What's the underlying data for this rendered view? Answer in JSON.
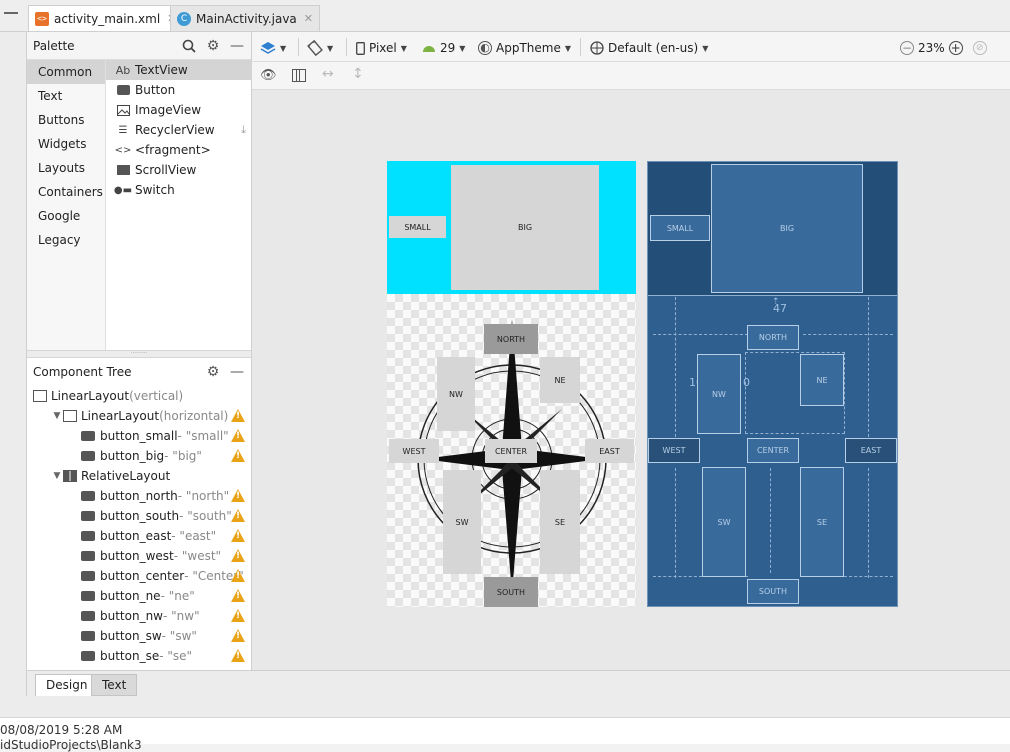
{
  "tabs": [
    {
      "label": "activity_main.xml",
      "icon": "xml-file-icon",
      "active": true
    },
    {
      "label": "MainActivity.java",
      "icon": "java-class-icon",
      "active": false
    }
  ],
  "palette": {
    "title": "Palette",
    "categories": [
      "Common",
      "Text",
      "Buttons",
      "Widgets",
      "Layouts",
      "Containers",
      "Google",
      "Legacy"
    ],
    "selected_category": "Common",
    "widgets": [
      {
        "label": "TextView",
        "icon": "Ab"
      },
      {
        "label": "Button",
        "icon": "button-icon"
      },
      {
        "label": "ImageView",
        "icon": "image-icon"
      },
      {
        "label": "RecyclerView",
        "icon": "list-icon"
      },
      {
        "label": "<fragment>",
        "icon": "code-icon"
      },
      {
        "label": "ScrollView",
        "icon": "scroll-icon"
      },
      {
        "label": "Switch",
        "icon": "switch-icon"
      }
    ]
  },
  "component_tree": {
    "title": "Component Tree",
    "rows": [
      {
        "name": "LinearLayout",
        "detail": "(vertical)",
        "level": 0,
        "arrow": "",
        "warn": false
      },
      {
        "name": "LinearLayout",
        "detail": "(horizontal)",
        "level": 1,
        "arrow": "▼",
        "warn": true
      },
      {
        "name": "button_small",
        "detail": "- \"small\"",
        "level": 2,
        "arrow": "",
        "warn": true
      },
      {
        "name": "button_big",
        "detail": "- \"big\"",
        "level": 2,
        "arrow": "",
        "warn": true
      },
      {
        "name": "RelativeLayout",
        "detail": "",
        "level": 1,
        "arrow": "▼",
        "warn": false
      },
      {
        "name": "button_north",
        "detail": "- \"north\"",
        "level": 2,
        "arrow": "",
        "warn": true
      },
      {
        "name": "button_south",
        "detail": "- \"south\"",
        "level": 2,
        "arrow": "",
        "warn": true
      },
      {
        "name": "button_east",
        "detail": "- \"east\"",
        "level": 2,
        "arrow": "",
        "warn": true
      },
      {
        "name": "button_west",
        "detail": "- \"west\"",
        "level": 2,
        "arrow": "",
        "warn": true
      },
      {
        "name": "button_center",
        "detail": "- \"Center\"",
        "level": 2,
        "arrow": "",
        "warn": true
      },
      {
        "name": "button_ne",
        "detail": "- \"ne\"",
        "level": 2,
        "arrow": "",
        "warn": true
      },
      {
        "name": "button_nw",
        "detail": "- \"nw\"",
        "level": 2,
        "arrow": "",
        "warn": true
      },
      {
        "name": "button_sw",
        "detail": "- \"sw\"",
        "level": 2,
        "arrow": "",
        "warn": true
      },
      {
        "name": "button_se",
        "detail": "- \"se\"",
        "level": 2,
        "arrow": "",
        "warn": true
      }
    ]
  },
  "toolbar": {
    "device": "Pixel",
    "api": "29",
    "theme": "AppTheme",
    "locale": "Default (en-us)",
    "zoom": "23%"
  },
  "bottom_tabs": [
    "Design",
    "Text"
  ],
  "log": {
    "line1": "08/08/2019 5:28 AM",
    "line2": "idStudioProjects\\Blank3"
  },
  "preview": {
    "small": "SMALL",
    "big": "BIG",
    "north": "NORTH",
    "south": "SOUTH",
    "east": "EAST",
    "west": "WEST",
    "center": "CENTER",
    "ne": "NE",
    "nw": "NW",
    "sw": "SW",
    "se": "SE",
    "margin_value": "47",
    "margin_left": "10",
    "margin_right": "0"
  },
  "colors": {
    "accent_cyan": "#00e0ff",
    "blueprint": "#2f5f8f",
    "warning": "#e8a317"
  }
}
